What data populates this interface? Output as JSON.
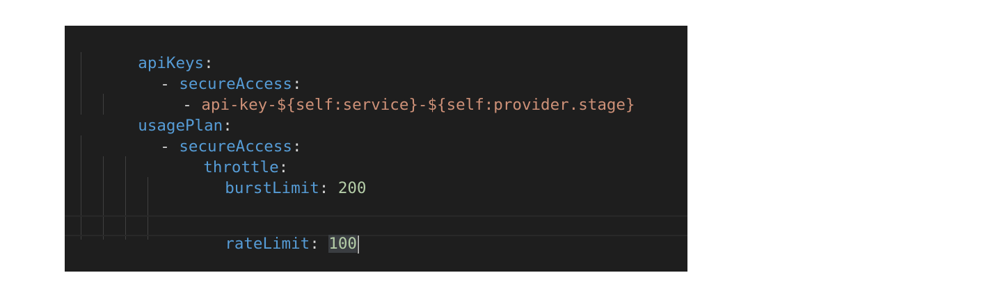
{
  "editor": {
    "language": "yaml",
    "colors": {
      "background": "#1e1e1e",
      "key": "#569cd6",
      "string": "#ce9178",
      "number": "#b5cea8",
      "punctuation": "#d4d4d4"
    },
    "lines": [
      {
        "key": "apiKeys",
        "colon": ":"
      },
      {
        "dash": "- ",
        "key": "secureAccess",
        "colon": ":"
      },
      {
        "dash": "- ",
        "value": "api-key-${self:service}-${self:provider.stage}"
      },
      {
        "key": "usagePlan",
        "colon": ":"
      },
      {
        "dash": "- ",
        "key": "secureAccess",
        "colon": ":"
      },
      {
        "key": "throttle",
        "colon": ":"
      },
      {
        "key": "burstLimit",
        "colon": ": ",
        "value": "200"
      },
      {
        "key": "rateLimit",
        "colon": ": ",
        "value": "100"
      }
    ]
  }
}
